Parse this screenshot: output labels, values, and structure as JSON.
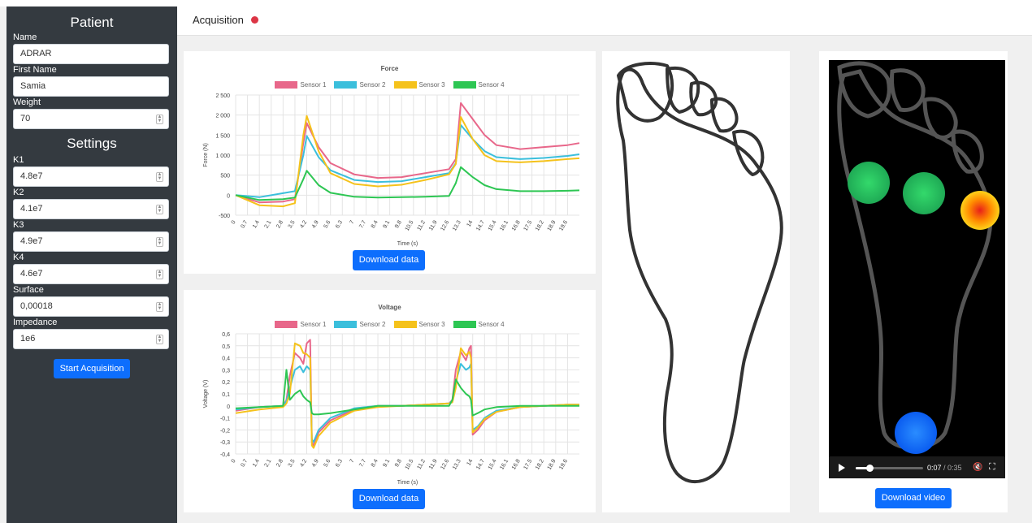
{
  "sidebar": {
    "patient_title": "Patient",
    "settings_title": "Settings",
    "patient_fields": [
      {
        "label": "Name",
        "value": "ADRAR",
        "spinner": false
      },
      {
        "label": "First Name",
        "value": "Samia",
        "spinner": false
      },
      {
        "label": "Weight",
        "value": "70",
        "spinner": true
      }
    ],
    "settings_fields": [
      {
        "label": "K1",
        "value": "4.8e7"
      },
      {
        "label": "K2",
        "value": "4.1e7"
      },
      {
        "label": "K3",
        "value": "4.9e7"
      },
      {
        "label": "K4",
        "value": "4.6e7"
      },
      {
        "label": "Surface",
        "value": "0,00018"
      },
      {
        "label": "Impedance",
        "value": "1e6"
      }
    ],
    "start_button": "Start Acquisition"
  },
  "header": {
    "title": "Acquisition",
    "status_color": "#dc3545"
  },
  "colors": {
    "sensor1": "#e8678a",
    "sensor2": "#3bbfdc",
    "sensor3": "#f5c21b",
    "sensor4": "#2dc653",
    "button": "#0d6efd"
  },
  "charts": {
    "download_label": "Download data",
    "x_ticks": [
      "0",
      "0.7",
      "1.4",
      "2.1",
      "2.8",
      "3.5",
      "4.2",
      "4.9",
      "5.6",
      "6.3",
      "7",
      "7.7",
      "8.4",
      "9.1",
      "9.8",
      "10.5",
      "11.2",
      "11.9",
      "12.6",
      "13.3",
      "14",
      "14.7",
      "15.4",
      "16.1",
      "16.8",
      "17.5",
      "18.2",
      "18.9",
      "19.6"
    ]
  },
  "chart_data": [
    {
      "type": "line",
      "title": "Force",
      "xlabel": "Time (s)",
      "ylabel": "Force (N)",
      "ylim": [
        -500,
        2500
      ],
      "yticks": [
        "2 500",
        "2 000",
        "1 500",
        "1 000",
        "500",
        "0",
        "-500"
      ],
      "ytick_values": [
        2500,
        2000,
        1500,
        1000,
        500,
        0,
        -500
      ],
      "grid": true,
      "legend": "top",
      "x": [
        0,
        1.4,
        2.8,
        3.5,
        4.0,
        4.2,
        4.9,
        5.6,
        7,
        8.4,
        9.8,
        11.2,
        12.6,
        13.0,
        13.3,
        14,
        14.7,
        15.4,
        16.8,
        18.2,
        19.6,
        20.3
      ],
      "series": [
        {
          "name": "Sensor 1",
          "values": [
            0,
            -180,
            -160,
            -100,
            1300,
            1800,
            1200,
            800,
            520,
            430,
            450,
            550,
            650,
            900,
            2300,
            1900,
            1500,
            1250,
            1150,
            1200,
            1250,
            1300
          ]
        },
        {
          "name": "Sensor 2",
          "values": [
            0,
            -50,
            50,
            100,
            1000,
            1480,
            950,
            620,
            380,
            330,
            350,
            450,
            550,
            800,
            1750,
            1400,
            1100,
            950,
            900,
            930,
            980,
            1020
          ]
        },
        {
          "name": "Sensor 3",
          "values": [
            0,
            -250,
            -280,
            -200,
            1500,
            1980,
            1100,
            550,
            280,
            220,
            260,
            380,
            520,
            780,
            1950,
            1400,
            1000,
            850,
            820,
            850,
            900,
            920
          ]
        },
        {
          "name": "Sensor 4",
          "values": [
            0,
            -120,
            -100,
            -60,
            400,
            610,
            250,
            60,
            -40,
            -60,
            -50,
            -40,
            -20,
            300,
            700,
            450,
            250,
            150,
            100,
            100,
            110,
            120
          ]
        }
      ]
    },
    {
      "type": "line",
      "title": "Voltage",
      "xlabel": "Time (s)",
      "ylabel": "Voltage (V)",
      "ylim": [
        -0.4,
        0.6
      ],
      "yticks": [
        "0,6",
        "0,5",
        "0,4",
        "0,3",
        "0,2",
        "0,1",
        "0",
        "-0,1",
        "-0,2",
        "-0,3",
        "-0,4"
      ],
      "ytick_values": [
        0.6,
        0.5,
        0.4,
        0.3,
        0.2,
        0.1,
        0,
        -0.1,
        -0.2,
        -0.3,
        -0.4
      ],
      "grid": true,
      "legend": "top",
      "x": [
        0,
        1.4,
        2.8,
        3.0,
        3.2,
        3.5,
        3.8,
        4.0,
        4.2,
        4.4,
        4.5,
        4.6,
        4.9,
        5.6,
        7,
        8.4,
        9.8,
        11.2,
        12.6,
        12.8,
        13.0,
        13.3,
        13.6,
        13.8,
        13.9,
        14.0,
        14.3,
        14.7,
        15.4,
        16.8,
        18.2,
        19.6,
        20.3
      ],
      "series": [
        {
          "name": "Sensor 1",
          "values": [
            -0.04,
            -0.01,
            0.0,
            0.05,
            0.25,
            0.44,
            0.4,
            0.35,
            0.52,
            0.55,
            -0.3,
            -0.33,
            -0.22,
            -0.12,
            -0.03,
            0.0,
            0.0,
            0.01,
            0.02,
            0.05,
            0.3,
            0.45,
            0.38,
            0.48,
            0.5,
            -0.24,
            -0.2,
            -0.12,
            -0.05,
            -0.01,
            0.0,
            0.01,
            0.01
          ]
        },
        {
          "name": "Sensor 2",
          "values": [
            -0.03,
            -0.01,
            0.0,
            0.04,
            0.15,
            0.3,
            0.33,
            0.28,
            0.33,
            0.3,
            -0.28,
            -0.3,
            -0.2,
            -0.1,
            -0.02,
            0.0,
            0.0,
            0.01,
            0.02,
            0.04,
            0.2,
            0.35,
            0.3,
            0.32,
            0.35,
            -0.2,
            -0.17,
            -0.1,
            -0.04,
            -0.01,
            0.0,
            0.01,
            0.01
          ]
        },
        {
          "name": "Sensor 3",
          "values": [
            -0.06,
            -0.03,
            -0.01,
            0.02,
            0.1,
            0.52,
            0.5,
            0.44,
            0.43,
            0.4,
            -0.33,
            -0.35,
            -0.25,
            -0.14,
            -0.04,
            -0.01,
            0.0,
            0.01,
            0.02,
            0.03,
            0.15,
            0.48,
            0.42,
            0.45,
            0.4,
            -0.22,
            -0.18,
            -0.11,
            -0.05,
            -0.01,
            0.0,
            0.01,
            0.01
          ]
        },
        {
          "name": "Sensor 4",
          "values": [
            -0.02,
            -0.01,
            0.0,
            0.3,
            0.05,
            0.1,
            0.13,
            0.08,
            0.05,
            0.03,
            -0.06,
            -0.07,
            -0.07,
            -0.06,
            -0.03,
            0.0,
            0.0,
            0.0,
            0.0,
            0.05,
            0.22,
            0.15,
            0.1,
            0.08,
            0.05,
            -0.08,
            -0.06,
            -0.03,
            -0.01,
            0.0,
            0.0,
            0.0,
            0.0
          ]
        }
      ]
    }
  ],
  "video": {
    "current_time": "0:07",
    "duration": "/ 0:35",
    "progress": 0.2,
    "download_label": "Download video"
  }
}
